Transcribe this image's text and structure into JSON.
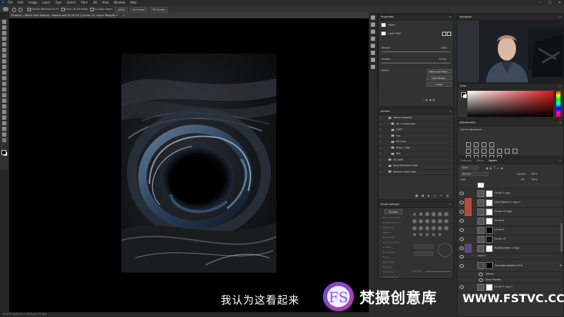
{
  "app": {
    "logo": "Ps",
    "menu": [
      "File",
      "Edit",
      "Image",
      "Layer",
      "Type",
      "Select",
      "Filter",
      "3D",
      "View",
      "Window",
      "Help"
    ],
    "window_controls": [
      "–",
      "□",
      "✕"
    ]
  },
  "options_bar": {
    "resize_windows": "Resize Windows to Fit",
    "zoom_all": "Zoom All Windows",
    "scrubby_zoom": "Scrubby Zoom",
    "zoom_pct": "100%",
    "fit_screen": "Fit Screen",
    "fill_screen": "Fill Screen"
  },
  "document": {
    "tab_title": "Photo(s) - Black Hole Mosaic - Master.psd @ 16.7% (Curves 13, Layer Mask/8) *",
    "status": "16.67%   2000 px × 3000 px (72 ppi)"
  },
  "properties": {
    "title": "Properties",
    "mask_label": "Masks",
    "layer_mask_label": "Layer Mask",
    "density_label": "Density:",
    "density_value": "100%",
    "feather_label": "Feather:",
    "feather_value": "0.0 px",
    "refine_label": "Refine:",
    "select_mask_btn": "Select and Mask...",
    "color_range_btn": "Color Range...",
    "invert_btn": "Invert"
  },
  "actions": {
    "title": "Actions",
    "items": [
      "Master Artboard",
      "PS + Surface Bro",
      "SORT",
      "Flat",
      "UR Grain",
      "Mirror + BW",
      "Bits",
      "PS CMYK",
      "Easy Geometric Grids",
      "Remove Layer Label"
    ]
  },
  "brush_settings": {
    "title": "Brush Settings",
    "brushes_btn": "Brushes",
    "options": [
      "Brush Tip Shape",
      "Shape Dynamics",
      "Scattering",
      "Texture",
      "Dual Brush",
      "Color Dynamics",
      "Transfer",
      "Brush Pose",
      "Noise",
      "Wet Edges",
      "Build-up",
      "Smoothing",
      "Protect Texture"
    ],
    "spacing_label": "Spacing"
  },
  "navigator": {
    "title": "Navigator"
  },
  "color": {
    "title": "Color"
  },
  "adjustments": {
    "title": "Adjustments",
    "subtitle": "Add an adjustment"
  },
  "layers": {
    "tabs": [
      "Channels",
      "Paths",
      "Layers"
    ],
    "search_kind": "Kind",
    "blend_mode": "Normal",
    "opacity_label": "Opacity:",
    "opacity_value": "100%",
    "lock_label": "Lock:",
    "fill_label": "Fill:",
    "fill_value": "100%",
    "rows": [
      "Curves 3 copy",
      "Color Balance 1 copy 4",
      "Curves 13 copy",
      "Curves 8",
      "Curves 9",
      "Curves 10",
      "Hue/Saturation 1 copy",
      "Layer 2",
      "Chocolate-splashes-Ul11t",
      "Effects",
      "Drop Shadow",
      "Curves 3 copy 2"
    ]
  },
  "overlay": {
    "subtitle": "我认为这看起来",
    "watermark_cn": "梵摄创意库",
    "watermark_url": "WWW.FSTVC.CC",
    "logo_letters": "FS"
  },
  "colors": {
    "accent": "#31a8ff",
    "logo_gradient_start": "#7b5cff",
    "logo_gradient_end": "#d94cc4",
    "active_layer_red": "#b84a38"
  }
}
